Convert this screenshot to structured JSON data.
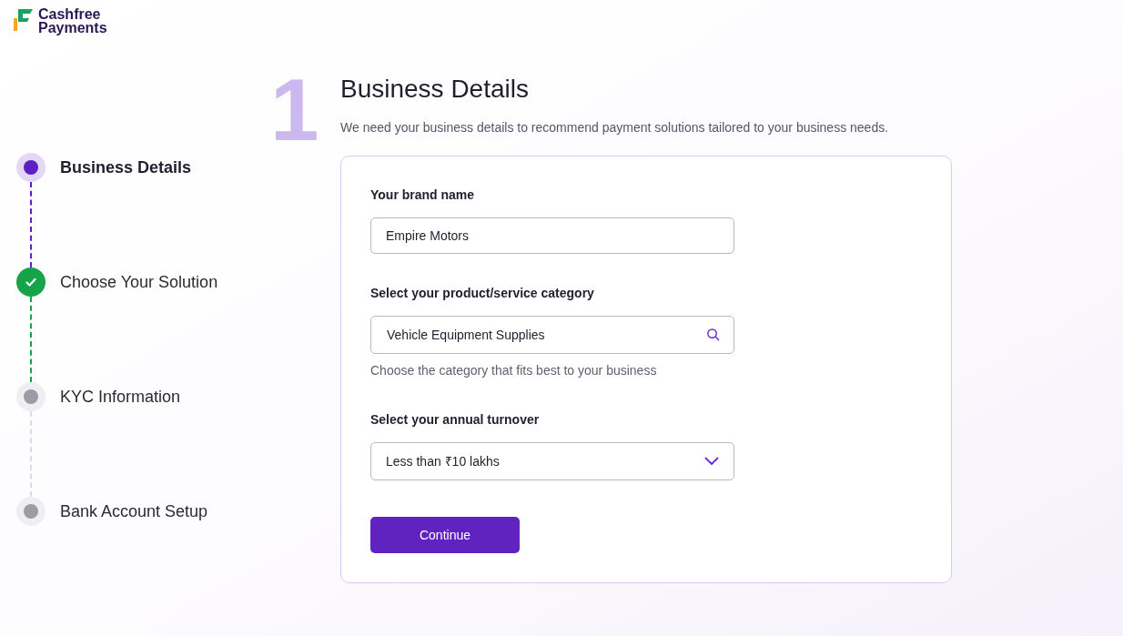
{
  "logo": {
    "line1": "Cashfree",
    "line2": "Payments"
  },
  "steps": [
    {
      "label": "Business Details",
      "kind": "active"
    },
    {
      "label": "Choose Your Solution",
      "kind": "done"
    },
    {
      "label": "KYC Information",
      "kind": "pending"
    },
    {
      "label": "Bank Account Setup",
      "kind": "pending"
    }
  ],
  "step_number": "1",
  "title": "Business Details",
  "subtitle": "We need your business details to recommend payment solutions tailored to your business needs.",
  "form": {
    "brand": {
      "label": "Your brand name",
      "value": "Empire Motors"
    },
    "category": {
      "label": "Select your product/service category",
      "value": "Vehicle Equipment Supplies",
      "hint": "Choose the category that fits best to your business"
    },
    "turnover": {
      "label": "Select your annual turnover",
      "value": "Less than ₹10 lakhs"
    },
    "button": "Continue"
  }
}
